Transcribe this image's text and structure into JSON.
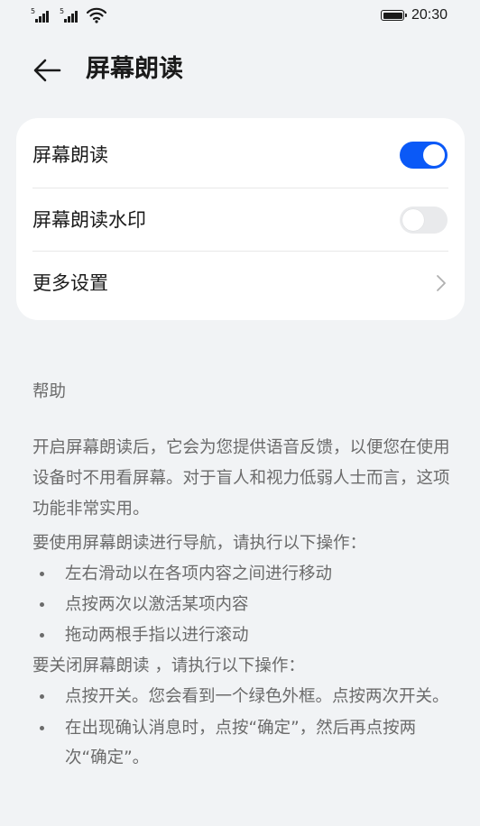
{
  "status_bar": {
    "sim1_tag": "5",
    "sim2_tag": "5",
    "time": "20:30",
    "icons": [
      "signal-icon",
      "signal-icon",
      "wifi-icon",
      "battery-icon"
    ]
  },
  "header": {
    "back_icon": "arrow-left-icon",
    "title": "屏幕朗读"
  },
  "settings": {
    "items": [
      {
        "label": "屏幕朗读",
        "control": "toggle",
        "state": "on"
      },
      {
        "label": "屏幕朗读水印",
        "control": "toggle",
        "state": "off"
      },
      {
        "label": "更多设置",
        "control": "chevron"
      }
    ]
  },
  "help": {
    "title": "帮助",
    "intro": "开启屏幕朗读后，它会为您提供语音反馈，以便您在使用设备时不用看屏幕。对于盲人和视力低弱人士而言，这项功能非常实用。",
    "nav_heading": "要使用屏幕朗读进行导航，请执行以下操作：",
    "nav_steps": [
      "左右滑动以在各项内容之间进行移动",
      "点按两次以激活某项内容",
      "拖动两根手指以进行滚动"
    ],
    "close_heading": "要关闭屏幕朗读 ，请执行以下操作：",
    "close_steps": [
      "点按开关。您会看到一个绿色外框。点按两次开关。",
      "在出现确认消息时，点按“确定”，然后再点按两次“确定”。"
    ]
  },
  "colors": {
    "background": "#f1f3f5",
    "card": "#ffffff",
    "accent": "#0a59f7",
    "text_primary": "#1a1a1a",
    "text_secondary": "#6b6b6b"
  }
}
